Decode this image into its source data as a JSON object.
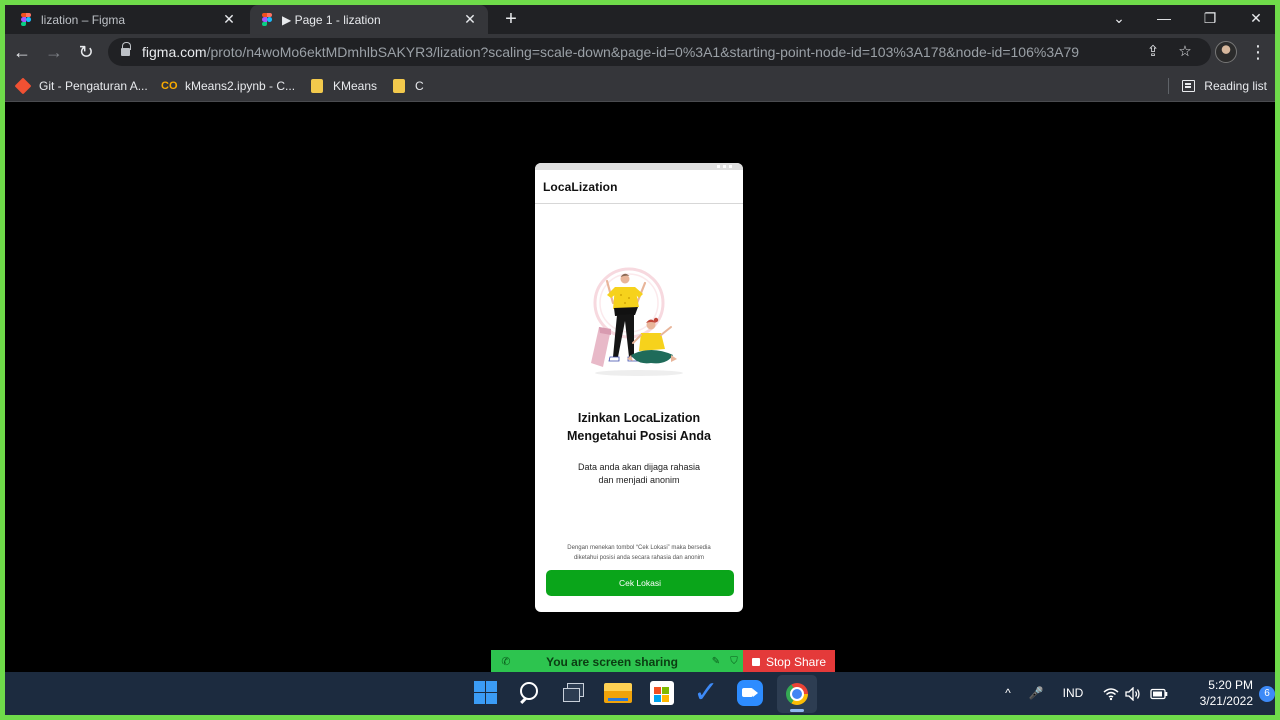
{
  "browser": {
    "tabs": [
      {
        "title": "lization – Figma",
        "close": "✕"
      },
      {
        "title": "▶ Page 1 - lization",
        "close": "✕"
      }
    ],
    "new_tab": "+",
    "window_controls": {
      "dropdown": "⌄",
      "minimize": "—",
      "restore": "❐",
      "close": "✕"
    },
    "nav": {
      "back": "←",
      "forward": "→",
      "reload": "↻"
    },
    "address": {
      "host": "figma.com",
      "path": "/proto/n4woMo6ektMDmhlbSAKYR3/lization?scaling=scale-down&page-id=0%3A1&starting-point-node-id=103%3A178&node-id=106%3A79"
    },
    "omnibox_icons": {
      "share": "⇪",
      "star": "☆"
    },
    "menu": "⋮",
    "bookmarks": [
      {
        "label": "Git - Pengaturan A...",
        "icon": "git-icon"
      },
      {
        "label": "kMeans2.ipynb - C...",
        "icon": "colab-icon"
      },
      {
        "label": "KMeans",
        "icon": "folder-icon"
      },
      {
        "label": "C",
        "icon": "folder-icon"
      }
    ],
    "reading_list": "Reading list"
  },
  "prototype": {
    "app_title": "LocaLization",
    "headline_line1": "Izinkan LocaLization",
    "headline_line2": "Mengetahui Posisi Anda",
    "sub_line1": "Data anda akan dijaga rahasia",
    "sub_line2": "dan menjadi anonim",
    "fine_line1": "Dengan menekan tombol “Cek Lokasi” maka bersedia",
    "fine_line2": "diketahui posisi anda secara rahasia dan anonim",
    "button": "Cek Lokasi",
    "colors": {
      "button": "#0aa51a",
      "shirt": "#f6d21c"
    }
  },
  "screenshare": {
    "status": "You are screen sharing",
    "stop": "Stop Share",
    "colors": {
      "bar": "#2dc44f",
      "stop": "#e43a3a"
    }
  },
  "taskbar": {
    "apps": [
      "start-icon",
      "search-icon",
      "task-view-icon",
      "file-explorer-icon",
      "microsoft-store-icon",
      "todo-icon",
      "zoom-icon",
      "chrome-icon"
    ],
    "tray": {
      "chevron": "^",
      "mic": "🎤",
      "lang": "IND",
      "wifi": "wifi-icon",
      "volume": "volume-icon",
      "battery": "battery-icon"
    },
    "time": "5:20 PM",
    "date": "3/21/2022",
    "notifications": "6"
  }
}
